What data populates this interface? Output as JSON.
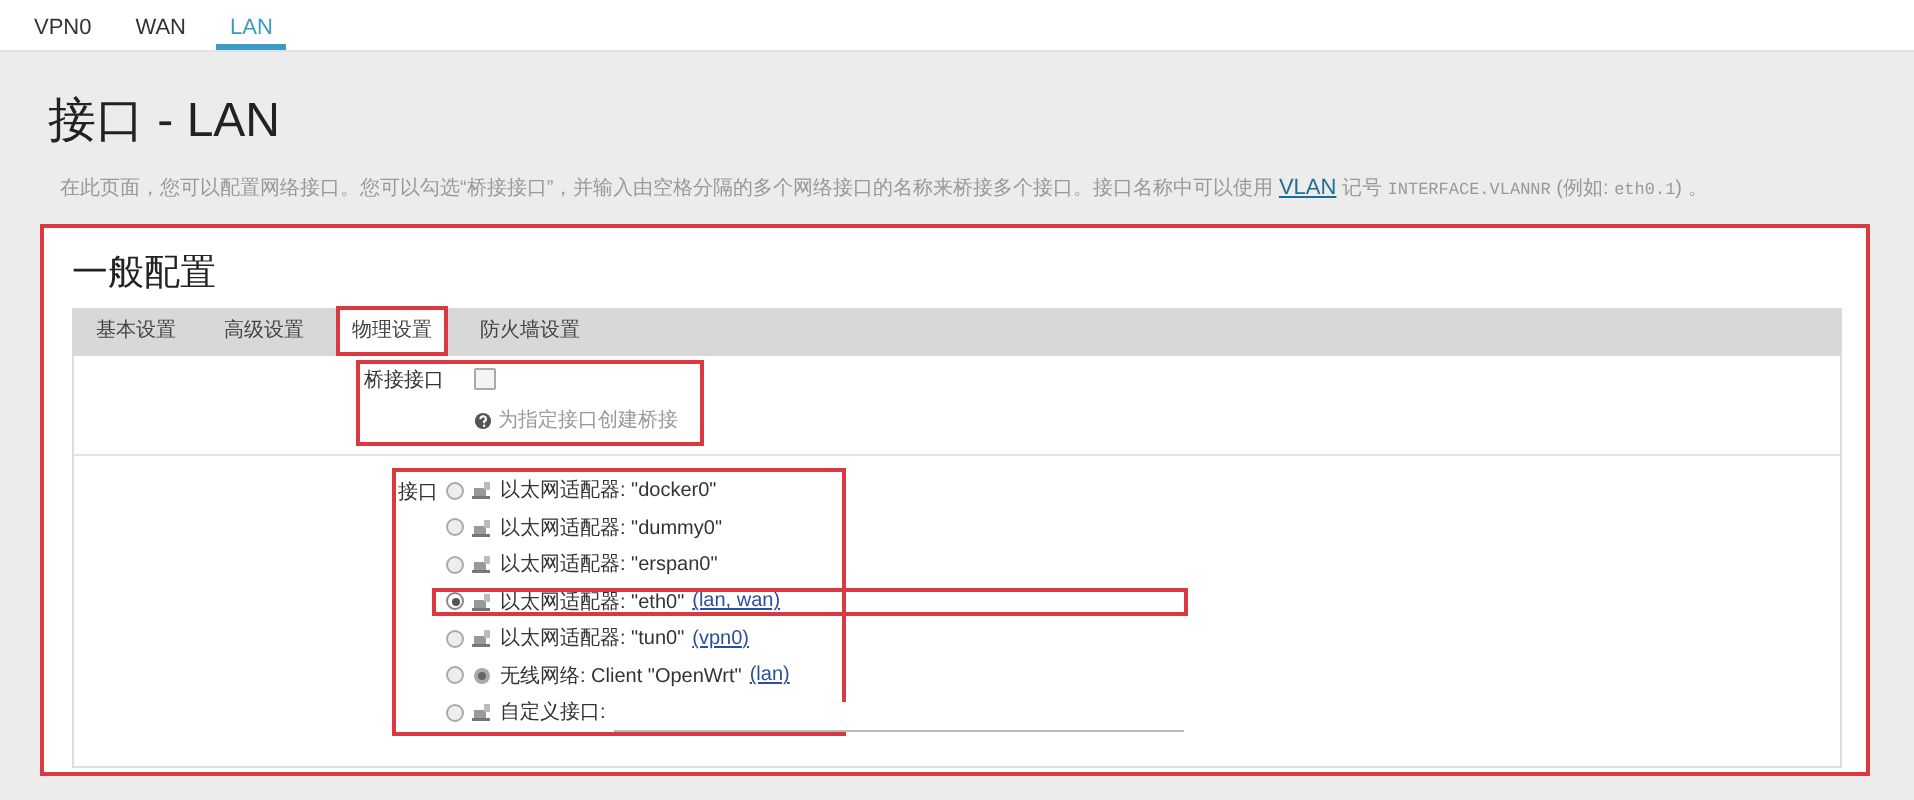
{
  "top_tabs": [
    {
      "label": "VPN0",
      "selected": false
    },
    {
      "label": "WAN",
      "selected": false
    },
    {
      "label": "LAN",
      "selected": true
    }
  ],
  "title": "接口 - LAN",
  "description": [
    {
      "kind": "text",
      "text": "在此页面，您可以配置网络接口。您可以勾选“桥接接口”，并输入由空格分隔的多个网络接口的名称来桥接多个接口。接口名称中可以使用 "
    },
    {
      "kind": "link",
      "text": "VLAN"
    },
    {
      "kind": "text",
      "text": " 记号 "
    },
    {
      "kind": "code",
      "text": "INTERFACE.VLANNR"
    },
    {
      "kind": "text",
      "text": " (例如: "
    },
    {
      "kind": "code",
      "text": "eth0.1"
    },
    {
      "kind": "text",
      "text": ") 。"
    }
  ],
  "section": {
    "title": "一般配置",
    "highlighted": true,
    "tabs": [
      {
        "label": "基本设置",
        "selected": false,
        "highlighted": false
      },
      {
        "label": "高级设置",
        "selected": false,
        "highlighted": false
      },
      {
        "label": "物理设置",
        "selected": true,
        "highlighted": true
      },
      {
        "label": "防火墙设置",
        "selected": false,
        "highlighted": false
      }
    ],
    "bridge": {
      "label": "桥接接口",
      "checked": false,
      "hint": "为指定接口创建桥接",
      "highlighted": true
    },
    "interface": {
      "label": "接口",
      "highlighted": true,
      "options": [
        {
          "kind": "ethernet",
          "label": "以太网适配器: \"docker0\"",
          "selected": false,
          "highlighted": false
        },
        {
          "kind": "ethernet",
          "label": "以太网适配器: \"dummy0\"",
          "selected": false,
          "highlighted": false
        },
        {
          "kind": "ethernet",
          "label": "以太网适配器: \"erspan0\"",
          "selected": false,
          "highlighted": false
        },
        {
          "kind": "ethernet",
          "label": "以太网适配器: \"eth0\"",
          "networks": "(lan, wan)",
          "selected": true,
          "highlighted": true
        },
        {
          "kind": "ethernet",
          "label": "以太网适配器: \"tun0\"",
          "networks": "(vpn0)",
          "selected": false,
          "highlighted": false
        },
        {
          "kind": "wireless",
          "label": "无线网络: Client \"OpenWrt\"",
          "networks": "(lan)",
          "selected": false,
          "highlighted": false
        },
        {
          "kind": "custom",
          "label": "自定义接口:",
          "selected": false,
          "highlighted": false
        }
      ]
    }
  }
}
